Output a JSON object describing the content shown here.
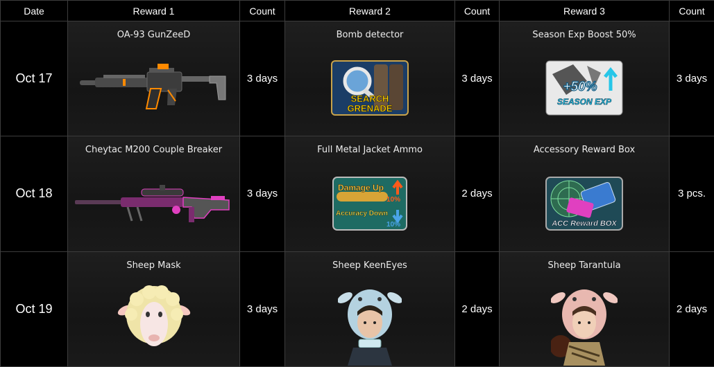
{
  "headers": {
    "date": "Date",
    "reward1": "Reward 1",
    "count1": "Count",
    "reward2": "Reward 2",
    "count2": "Count",
    "reward3": "Reward 3",
    "count3": "Count"
  },
  "rows": [
    {
      "date": "Oct 17",
      "r1": {
        "name": "OA-93 GunZeeD",
        "icon": "assault-rifle-icon"
      },
      "c1": "3 days",
      "r2": {
        "name": "Bomb detector",
        "icon": "search-grenade-icon",
        "label_top": "SEARCH",
        "label_bottom": "GRENADE"
      },
      "c2": "3 days",
      "r3": {
        "name": "Season Exp Boost 50%",
        "icon": "season-exp-boost-icon",
        "label_top": "+50%",
        "label_bottom": "SEASON EXP"
      },
      "c3": "3 days"
    },
    {
      "date": "Oct 18",
      "r1": {
        "name": "Cheytac M200 Couple Breaker",
        "icon": "sniper-rifle-icon"
      },
      "c1": "3 days",
      "r2": {
        "name": "Full Metal Jacket Ammo",
        "icon": "ammo-icon",
        "label_top": "Damage Up",
        "label_top_pct": "10%",
        "label_bottom": "Accuracy Down",
        "label_bottom_pct": "10%"
      },
      "c2": "2 days",
      "r3": {
        "name": "Accessory Reward Box",
        "icon": "acc-reward-box-icon",
        "label_bottom": "ACC Reward BOX"
      },
      "c3": "3 pcs."
    },
    {
      "date": "Oct 19",
      "r1": {
        "name": "Sheep Mask",
        "icon": "sheep-mask-icon"
      },
      "c1": "3 days",
      "r2": {
        "name": "Sheep KeenEyes",
        "icon": "character-blue-hood-icon"
      },
      "c2": "2 days",
      "r3": {
        "name": "Sheep Tarantula",
        "icon": "character-pink-hood-icon"
      },
      "c3": "2 days"
    }
  ],
  "colors": {
    "border": "#3d3d3d",
    "header_bg": "#000000",
    "cell_bg": "#1a1a1a",
    "text": "#ffffff",
    "accent_orange": "#ff8a00",
    "accent_pink": "#e040c0",
    "accent_cyan": "#27c6e8"
  }
}
